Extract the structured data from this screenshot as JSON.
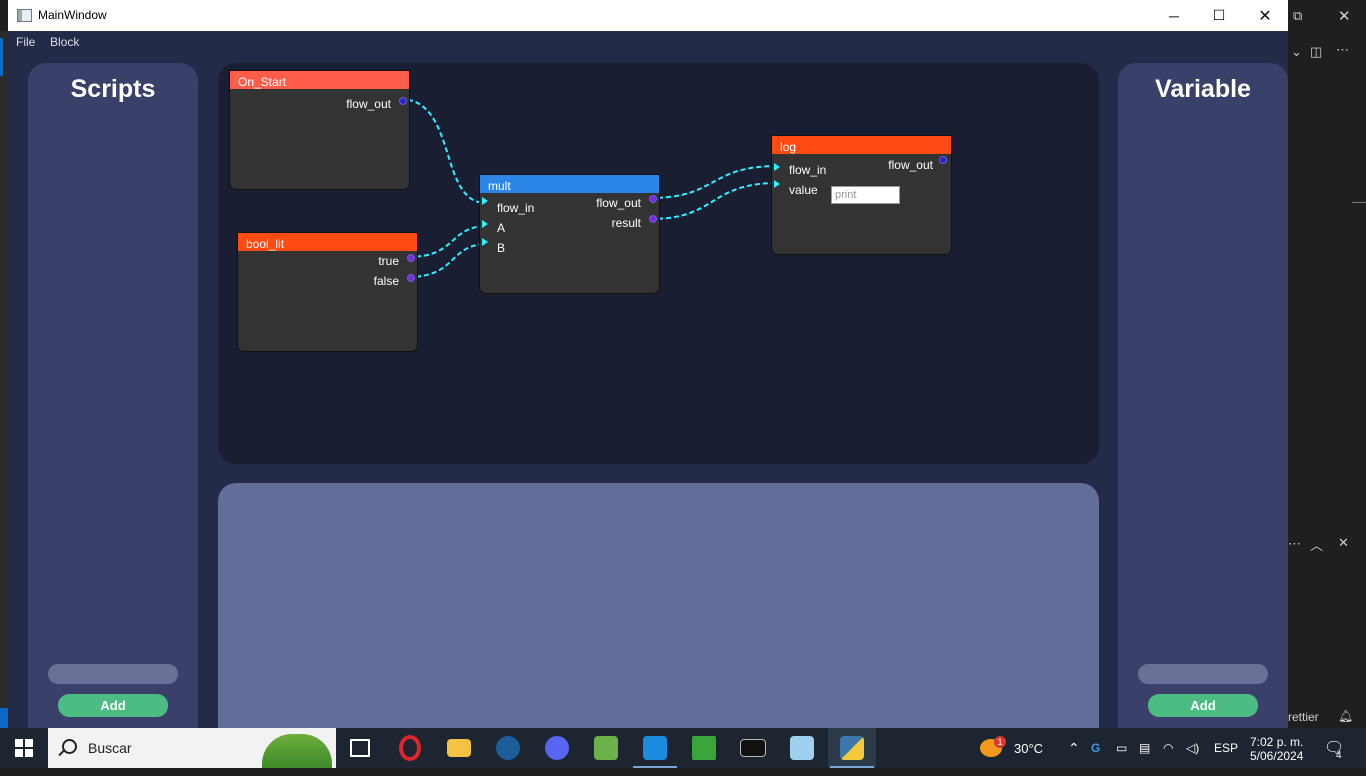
{
  "window": {
    "title": "MainWindow",
    "minimize_glyph": "─",
    "maximize_glyph": "☐",
    "close_glyph": "✕"
  },
  "menu": [
    "File",
    "Block"
  ],
  "scripts_panel": {
    "title": "Scripts",
    "add_label": "Add"
  },
  "variable_panel": {
    "title": "Variable",
    "add_label": "Add"
  },
  "nodes": {
    "on_start": {
      "title": "On_Start",
      "color": "#ff5c4a",
      "outputs": [
        "flow_out"
      ]
    },
    "bool_lit": {
      "title": "bool_lit",
      "color": "#ff4a12",
      "outputs": [
        "true",
        "false"
      ]
    },
    "mult": {
      "title": "mult",
      "color": "#2b86e8",
      "inputs": [
        "flow_in",
        "A",
        "B"
      ],
      "outputs": [
        "flow_out",
        "result"
      ]
    },
    "log": {
      "title": "log",
      "color": "#ff4a12",
      "inputs": [
        "flow_in",
        "value"
      ],
      "outputs": [
        "flow_out"
      ],
      "value_placeholder": "print"
    }
  },
  "colors": {
    "connection": "#2ef3ff",
    "add_button": "#4dbb84"
  },
  "background_app": {
    "status_text": "rettier"
  },
  "taskbar": {
    "search_placeholder": "Buscar",
    "apps": [
      "task-view",
      "opera",
      "file-explorer",
      "steam",
      "discord",
      "android-studio",
      "vscode",
      "minecraft",
      "terminal",
      "notepad",
      "python"
    ],
    "weather": "30°C",
    "weather_badge": "1",
    "language": "ESP",
    "time": "7:02 p. m.",
    "date": "5/06/2024",
    "notifications": "4"
  }
}
